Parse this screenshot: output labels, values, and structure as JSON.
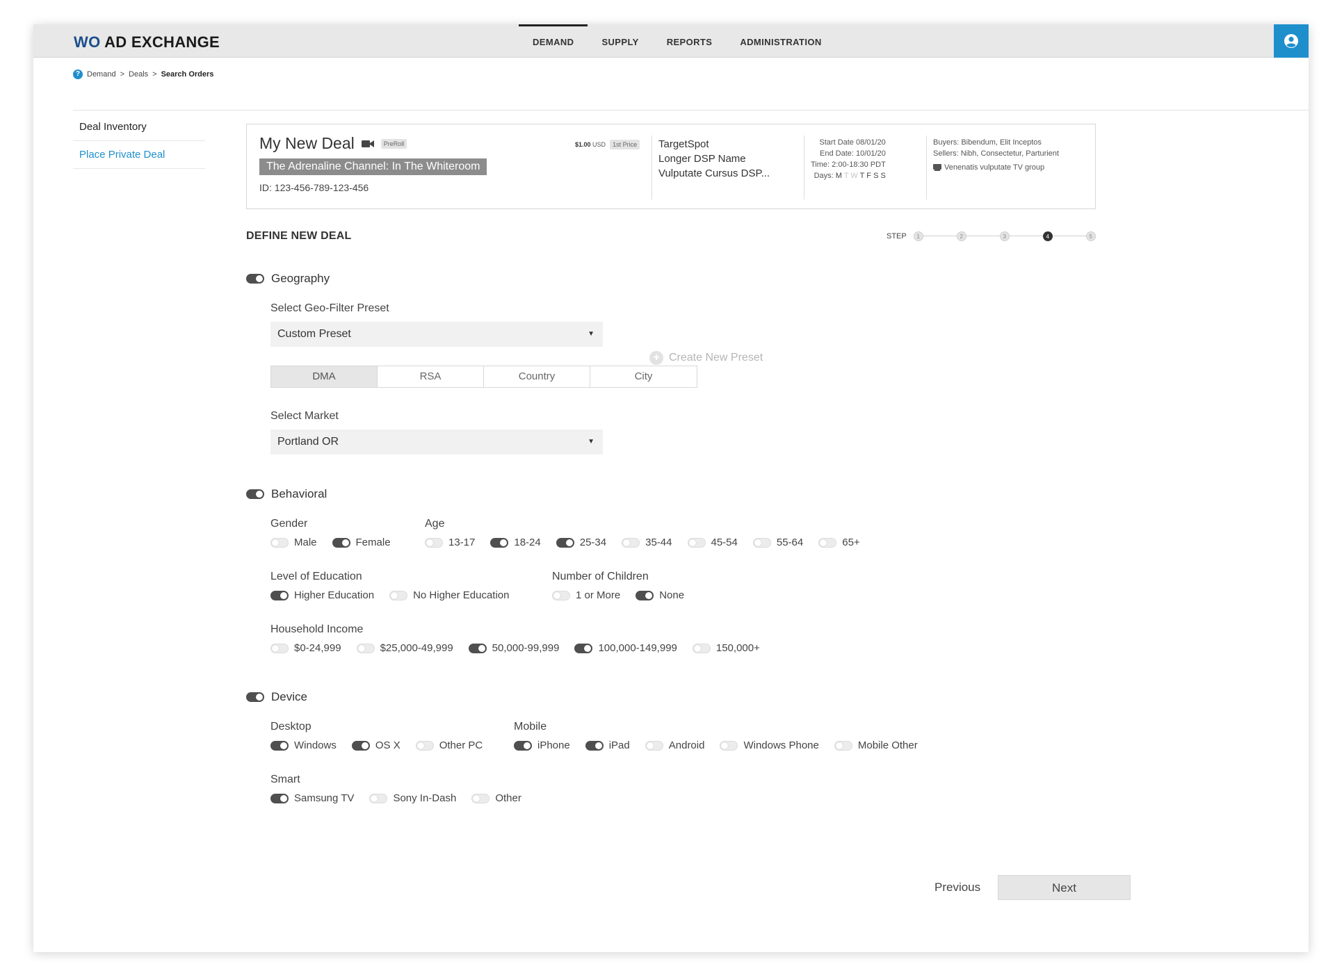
{
  "app": {
    "brand_prefix": "WO",
    "brand_rest": " AD EXCHANGE"
  },
  "nav": {
    "items": [
      "DEMAND",
      "SUPPLY",
      "REPORTS",
      "ADMINISTRATION"
    ],
    "active": "DEMAND"
  },
  "breadcrumb": {
    "parts": [
      "Demand",
      ">",
      "Deals",
      ">"
    ],
    "current": "Search Orders"
  },
  "sidebar": {
    "items": [
      {
        "label": "Deal Inventory"
      },
      {
        "label": "Place Private Deal"
      }
    ]
  },
  "deal": {
    "title": "My New Deal",
    "format_tag": "PreRoll",
    "channel": "The Adrenaline Channel: In The Whiteroom",
    "id_text": "ID: 123-456-789-123-456",
    "price": "$1.00",
    "currency": "USD",
    "price_type": "1st Price",
    "dsps": [
      "TargetSpot",
      "Longer DSP Name",
      "Vulputate Cursus DSP..."
    ],
    "start_date": "Start Date 08/01/20",
    "end_date": "End Date: 10/01/20",
    "time": "Time: 2:00-18:30 PDT",
    "days_label": "Days:",
    "days": [
      "M",
      "T",
      "W",
      "T",
      "F",
      "S",
      "S"
    ],
    "days_active": [
      true,
      false,
      false,
      true,
      true,
      true,
      true
    ],
    "buyers": "Buyers: Bibendum, Elit Inceptos",
    "sellers": "Sellers: Nibh, Consectetur, Parturient",
    "tv_group": "Venenatis vulputate TV group"
  },
  "section": {
    "title": "DEFINE NEW DEAL"
  },
  "steps": {
    "label": "STEP",
    "items": [
      "1",
      "2",
      "3",
      "4",
      "5"
    ],
    "current": 4
  },
  "geography": {
    "title": "Geography",
    "enabled": true,
    "preset_label": "Select Geo-Filter Preset",
    "preset_value": "Custom Preset",
    "create_preset": "Create New Preset",
    "tabs": [
      "DMA",
      "RSA",
      "Country",
      "City"
    ],
    "active_tab": "DMA",
    "market_label": "Select Market",
    "market_value": "Portland OR"
  },
  "behavioral": {
    "title": "Behavioral",
    "enabled": true,
    "gender_label": "Gender",
    "gender": [
      {
        "label": "Male",
        "on": false
      },
      {
        "label": "Female",
        "on": true
      }
    ],
    "age_label": "Age",
    "age": [
      {
        "label": "13-17",
        "on": false
      },
      {
        "label": "18-24",
        "on": true
      },
      {
        "label": "25-34",
        "on": true
      },
      {
        "label": "35-44",
        "on": false
      },
      {
        "label": "45-54",
        "on": false
      },
      {
        "label": "55-64",
        "on": false
      },
      {
        "label": "65+",
        "on": false
      }
    ],
    "education_label": "Level of Education",
    "education": [
      {
        "label": "Higher Education",
        "on": true
      },
      {
        "label": "No Higher Education",
        "on": false
      }
    ],
    "children_label": "Number of Children",
    "children": [
      {
        "label": "1 or More",
        "on": false
      },
      {
        "label": "None",
        "on": true
      }
    ],
    "income_label": "Household Income",
    "income": [
      {
        "label": "$0-24,999",
        "on": false
      },
      {
        "label": "$25,000-49,999",
        "on": false
      },
      {
        "label": "50,000-99,999",
        "on": true
      },
      {
        "label": "100,000-149,999",
        "on": true
      },
      {
        "label": "150,000+",
        "on": false
      }
    ]
  },
  "device": {
    "title": "Device",
    "enabled": true,
    "desktop_label": "Desktop",
    "desktop": [
      {
        "label": "Windows",
        "on": true
      },
      {
        "label": "OS X",
        "on": true
      },
      {
        "label": "Other PC",
        "on": false
      }
    ],
    "mobile_label": "Mobile",
    "mobile": [
      {
        "label": "iPhone",
        "on": true
      },
      {
        "label": "iPad",
        "on": true
      },
      {
        "label": "Android",
        "on": false
      },
      {
        "label": "Windows Phone",
        "on": false
      },
      {
        "label": "Mobile Other",
        "on": false
      }
    ],
    "smart_label": "Smart",
    "smart": [
      {
        "label": "Samsung TV",
        "on": true
      },
      {
        "label": "Sony In-Dash",
        "on": false
      },
      {
        "label": "Other",
        "on": false
      }
    ]
  },
  "buttons": {
    "previous": "Previous",
    "next": "Next"
  }
}
